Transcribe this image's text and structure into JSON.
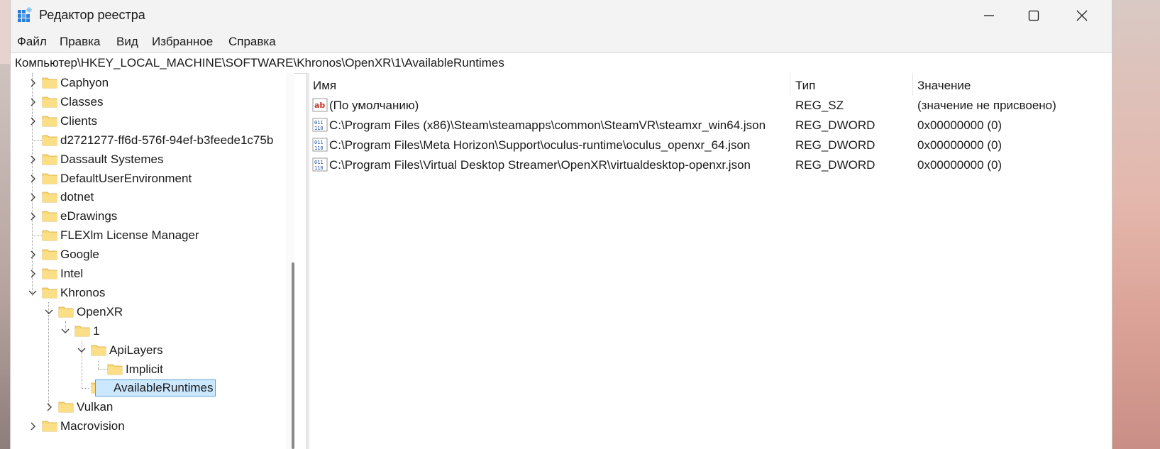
{
  "window": {
    "title": "Редактор реестра",
    "icon": "regedit-icon"
  },
  "menu": [
    "Файл",
    "Правка",
    "Вид",
    "Избранное",
    "Справка"
  ],
  "address": "Компьютер\\HKEY_LOCAL_MACHINE\\SOFTWARE\\Khronos\\OpenXR\\1\\AvailableRuntimes",
  "tree": [
    {
      "label": "Caphyon",
      "level": 0,
      "expander": "collapsed"
    },
    {
      "label": "Classes",
      "level": 0,
      "expander": "collapsed"
    },
    {
      "label": "Clients",
      "level": 0,
      "expander": "collapsed"
    },
    {
      "label": "d2721277-ff6d-576f-94ef-b3feede1c75b",
      "level": 0,
      "expander": "none"
    },
    {
      "label": "Dassault Systemes",
      "level": 0,
      "expander": "collapsed"
    },
    {
      "label": "DefaultUserEnvironment",
      "level": 0,
      "expander": "collapsed"
    },
    {
      "label": "dotnet",
      "level": 0,
      "expander": "collapsed"
    },
    {
      "label": "eDrawings",
      "level": 0,
      "expander": "collapsed"
    },
    {
      "label": "FLEXlm License Manager",
      "level": 0,
      "expander": "none"
    },
    {
      "label": "Google",
      "level": 0,
      "expander": "collapsed"
    },
    {
      "label": "Intel",
      "level": 0,
      "expander": "collapsed"
    },
    {
      "label": "Khronos",
      "level": 0,
      "expander": "expanded"
    },
    {
      "label": "OpenXR",
      "level": 1,
      "expander": "expanded"
    },
    {
      "label": "1",
      "level": 2,
      "expander": "expanded"
    },
    {
      "label": "ApiLayers",
      "level": 3,
      "expander": "expanded"
    },
    {
      "label": "Implicit",
      "level": 4,
      "expander": "none"
    },
    {
      "label": "AvailableRuntimes",
      "level": 3,
      "expander": "none",
      "selected": true
    },
    {
      "label": "Vulkan",
      "level": 1,
      "expander": "collapsed"
    },
    {
      "label": "Macrovision",
      "level": 0,
      "expander": "collapsed"
    }
  ],
  "list": {
    "columns": [
      "Имя",
      "Тип",
      "Значение"
    ],
    "rows": [
      {
        "icon": "string-value-icon",
        "name": "(По умолчанию)",
        "type": "REG_SZ",
        "value": "(значение не присвоено)"
      },
      {
        "icon": "binary-value-icon",
        "name": "C:\\Program Files (x86)\\Steam\\steamapps\\common\\SteamVR\\steamxr_win64.json",
        "type": "REG_DWORD",
        "value": "0x00000000 (0)"
      },
      {
        "icon": "binary-value-icon",
        "name": "C:\\Program Files\\Meta Horizon\\Support\\oculus-runtime\\oculus_openxr_64.json",
        "type": "REG_DWORD",
        "value": "0x00000000 (0)"
      },
      {
        "icon": "binary-value-icon",
        "name": "C:\\Program Files\\Virtual Desktop Streamer\\OpenXR\\virtualdesktop-openxr.json",
        "type": "REG_DWORD",
        "value": "0x00000000 (0)"
      }
    ]
  },
  "colors": {
    "folder": "#f8d775",
    "selection": "#cce8ff",
    "selection_border": "#5a9fd4"
  }
}
